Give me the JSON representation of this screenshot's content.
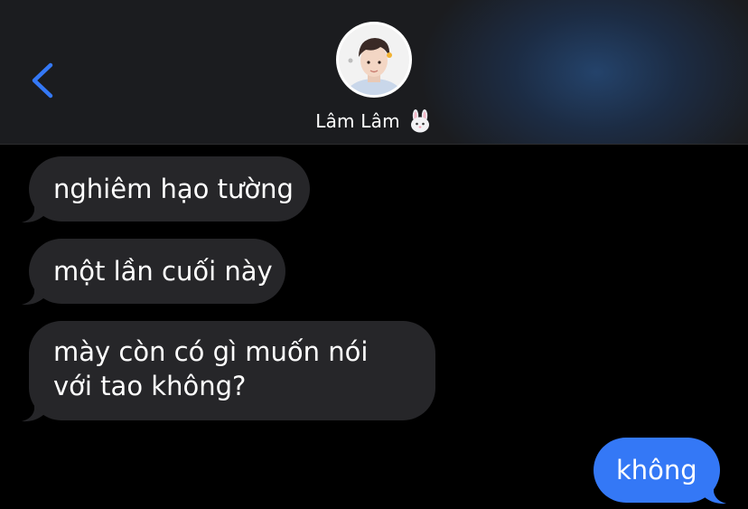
{
  "header": {
    "contact_name": "Lâm Lâm",
    "contact_emoji_icon": "rabbit-face-icon",
    "back_icon": "chevron-left-icon"
  },
  "colors": {
    "accent": "#3478f6",
    "incoming_bubble": "#262629",
    "outgoing_bubble": "#3478f6",
    "background": "#000000"
  },
  "messages": [
    {
      "direction": "incoming",
      "text": "nghiêm hạo tường"
    },
    {
      "direction": "incoming",
      "text": "một lần cuối này"
    },
    {
      "direction": "incoming",
      "text": "mày còn có gì muốn nói với tao không?"
    },
    {
      "direction": "outgoing",
      "text": "không"
    }
  ]
}
